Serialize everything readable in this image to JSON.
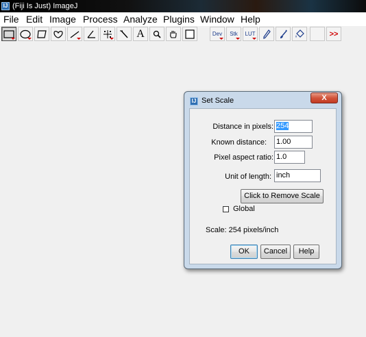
{
  "window": {
    "title": "(Fiji Is Just) ImageJ",
    "icon": "fiji-app-icon"
  },
  "menubar": [
    "File",
    "Edit",
    "Image",
    "Process",
    "Analyze",
    "Plugins",
    "Window",
    "Help"
  ],
  "toolbar": {
    "tools": [
      {
        "name": "rectangle-tool-icon",
        "selected": true
      },
      {
        "name": "oval-tool-icon"
      },
      {
        "name": "polygon-tool-icon"
      },
      {
        "name": "freehand-tool-icon"
      },
      {
        "name": "line-tool-icon"
      },
      {
        "name": "angle-tool-icon"
      },
      {
        "name": "multipoint-tool-icon"
      },
      {
        "name": "wand-tool-icon"
      },
      {
        "name": "text-tool-icon"
      },
      {
        "name": "magnifier-tool-icon"
      },
      {
        "name": "hand-tool-icon"
      },
      {
        "name": "color-picker-tool-icon"
      },
      {
        "name": "dev-tool-icon",
        "label": "Dev"
      },
      {
        "name": "stk-tool-icon",
        "label": "Stk"
      },
      {
        "name": "lut-tool-icon",
        "label": "LUT"
      },
      {
        "name": "pencil-tool-icon"
      },
      {
        "name": "brush-tool-icon"
      },
      {
        "name": "flood-fill-tool-icon"
      },
      {
        "name": "more-tools-icon",
        "label": ">>"
      }
    ],
    "text_tool_label": "A"
  },
  "dialog": {
    "title": "Set Scale",
    "close_label": "X",
    "fields": {
      "distance_label": "Distance in pixels:",
      "distance_value": "254",
      "known_label": "Known distance:",
      "known_value": "1.00",
      "aspect_label": "Pixel aspect ratio:",
      "aspect_value": "1.0",
      "unit_label": "Unit of length:",
      "unit_value": "inch"
    },
    "remove_scale_label": "Click to Remove Scale",
    "global_label": "Global",
    "global_checked": false,
    "scale_text": "Scale: 254 pixels/inch",
    "buttons": {
      "ok": "OK",
      "cancel": "Cancel",
      "help": "Help"
    }
  }
}
